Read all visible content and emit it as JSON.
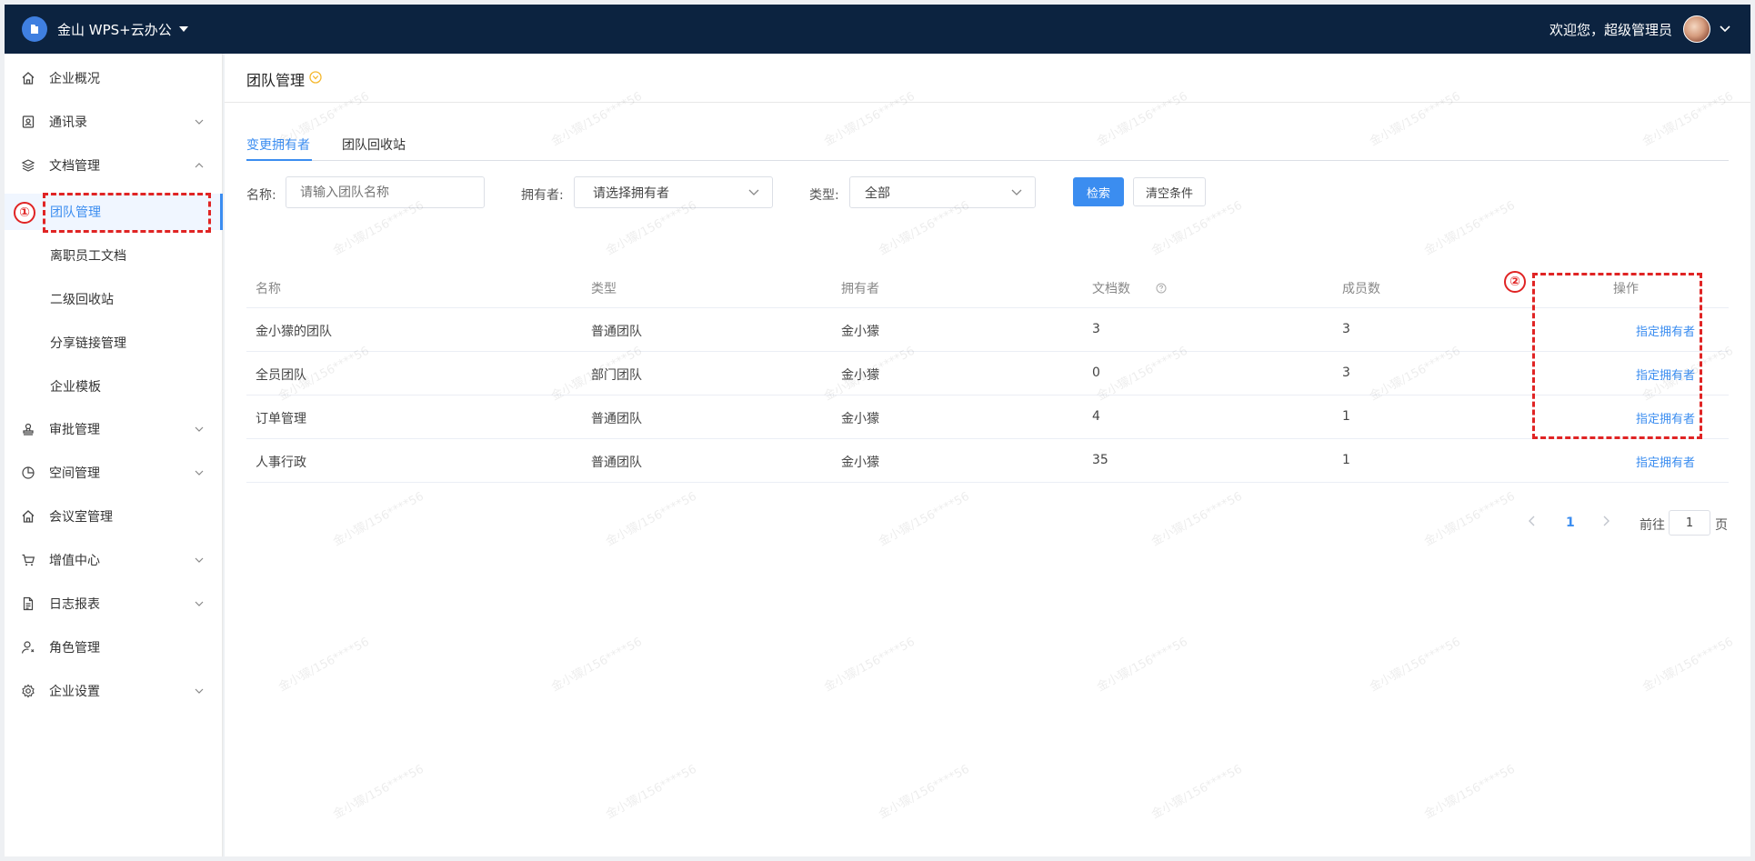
{
  "topbar": {
    "brand": "金山 WPS+云办公",
    "welcome": "欢迎您，超级管理员"
  },
  "sidebar": {
    "items": [
      {
        "label": "企业概况",
        "icon": "home-icon",
        "expandable": false
      },
      {
        "label": "通讯录",
        "icon": "contacts-icon",
        "expandable": true
      },
      {
        "label": "文档管理",
        "icon": "layers-icon",
        "expandable": true,
        "expanded": true
      },
      {
        "label": "团队管理",
        "sub": true,
        "active": true
      },
      {
        "label": "离职员工文档",
        "sub": true
      },
      {
        "label": "二级回收站",
        "sub": true
      },
      {
        "label": "分享链接管理",
        "sub": true
      },
      {
        "label": "企业模板",
        "sub": true
      },
      {
        "label": "审批管理",
        "icon": "stamp-icon",
        "expandable": true
      },
      {
        "label": "空间管理",
        "icon": "pie-chart-icon",
        "expandable": true
      },
      {
        "label": "会议室管理",
        "icon": "home-icon",
        "expandable": false
      },
      {
        "label": "增值中心",
        "icon": "cart-icon",
        "expandable": true
      },
      {
        "label": "日志报表",
        "icon": "file-text-icon",
        "expandable": true
      },
      {
        "label": "角色管理",
        "icon": "user-gear-icon",
        "expandable": false
      },
      {
        "label": "企业设置",
        "icon": "gear-icon",
        "expandable": true
      }
    ]
  },
  "page": {
    "title": "团队管理"
  },
  "tabs": [
    {
      "label": "变更拥有者",
      "active": true
    },
    {
      "label": "团队回收站",
      "active": false
    }
  ],
  "filters": {
    "name_label": "名称:",
    "name_placeholder": "请输入团队名称",
    "owner_label": "拥有者:",
    "owner_value": "请选择拥有者",
    "type_label": "类型:",
    "type_value": "全部",
    "search_button": "检索",
    "clear_button": "清空条件"
  },
  "table": {
    "headers": [
      "名称",
      "类型",
      "拥有者",
      "文档数",
      "成员数",
      "操作"
    ],
    "rows": [
      {
        "name": "金小獴的团队",
        "type": "普通团队",
        "owner": "金小獴",
        "docs": "3",
        "members": "3",
        "action": "指定拥有者"
      },
      {
        "name": "全员团队",
        "type": "部门团队",
        "owner": "金小獴",
        "docs": "0",
        "members": "3",
        "action": "指定拥有者"
      },
      {
        "name": "订单管理",
        "type": "普通团队",
        "owner": "金小獴",
        "docs": "4",
        "members": "1",
        "action": "指定拥有者"
      },
      {
        "name": "人事行政",
        "type": "普通团队",
        "owner": "金小獴",
        "docs": "35",
        "members": "1",
        "action": "指定拥有者"
      }
    ]
  },
  "pagination": {
    "current": "1",
    "goto_prefix": "前往",
    "goto_value": "1",
    "goto_suffix": "页"
  },
  "annotations": {
    "one": "①",
    "two": "②"
  },
  "watermark": "金小獴/156****56",
  "colors": {
    "topbar": "#0c2340",
    "accent": "#3b8df0",
    "annotation": "#e02424"
  }
}
